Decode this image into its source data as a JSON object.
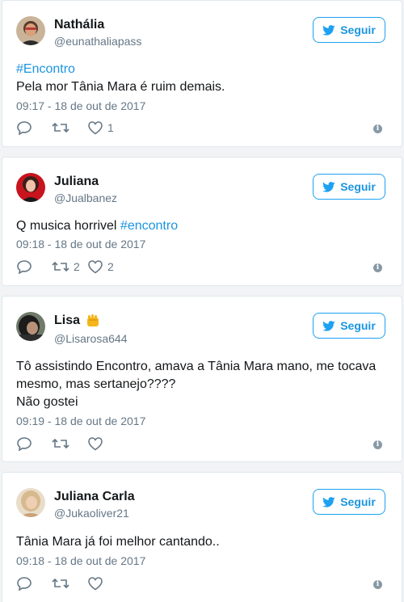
{
  "follow_label": "Seguir",
  "tweets": [
    {
      "name": "Nathália",
      "handle": "@eunathaliapass",
      "hashtag": "#Encontro",
      "text": "Pela mor Tânia Mara é ruim demais.",
      "timestamp": "09:17 - 18 de out de 2017",
      "retweets": "",
      "likes": "1"
    },
    {
      "name": "Juliana",
      "handle": "@Jualbanez",
      "text_prefix": "Q musica horrivel ",
      "hashtag": "#encontro",
      "timestamp": "09:18 - 18 de out de 2017",
      "retweets": "2",
      "likes": "2"
    },
    {
      "name": "Lisa",
      "name_emoji": "fist-emoji",
      "handle": "@Lisarosa644",
      "text_line1": "Tô assistindo Encontro, amava a Tânia Mara mano, me tocava",
      "text_line2": "mesmo, mas sertanejo????",
      "text_line3": "Não gostei",
      "timestamp": "09:19 - 18 de out de 2017",
      "retweets": "",
      "likes": ""
    },
    {
      "name": "Juliana Carla",
      "handle": "@Jukaoliver21",
      "text": "Tânia Mara já foi melhor cantando..",
      "timestamp": "09:18 - 18 de out de 2017",
      "retweets": "",
      "likes": ""
    }
  ],
  "colors": {
    "accent": "#1da1f2",
    "link": "#1b95e0",
    "muted": "#657786",
    "background": "#f1f3f5"
  }
}
